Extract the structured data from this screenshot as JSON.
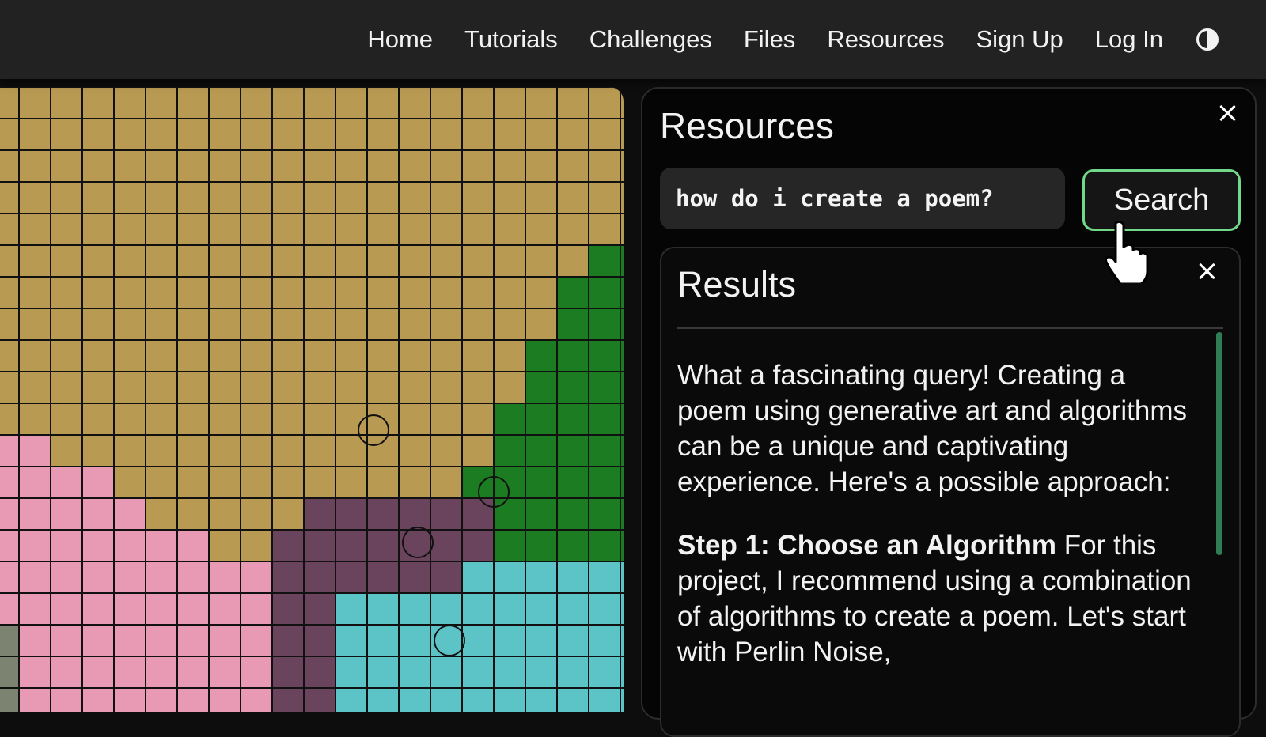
{
  "nav": {
    "items": [
      "Home",
      "Tutorials",
      "Challenges",
      "Files",
      "Resources",
      "Sign Up",
      "Log In"
    ],
    "theme_toggle_icon": "contrast-icon"
  },
  "canvas": {
    "grid_colors": {
      "tan": "#b89a52",
      "green": "#1c7c21",
      "pink": "#e89ab5",
      "purple": "#6a435d",
      "teal": "#5cc4c6",
      "gray": "#7c8471"
    }
  },
  "panel": {
    "title": "Resources",
    "search": {
      "value": "how do i create a poem?",
      "button_label": "Search"
    },
    "results": {
      "title": "Results",
      "intro": "What a fascinating query! Creating a poem using generative art and algorithms can be a unique and captivating experience. Here's a possible approach:",
      "step_heading": "Step 1: Choose an Algorithm",
      "step_text": " For this project, I recommend using a combination of algorithms to create a poem. Let's start with Perlin Noise,"
    }
  },
  "colors": {
    "search_button_border": "#73d98a",
    "scrollbar": "#2e7d55"
  }
}
